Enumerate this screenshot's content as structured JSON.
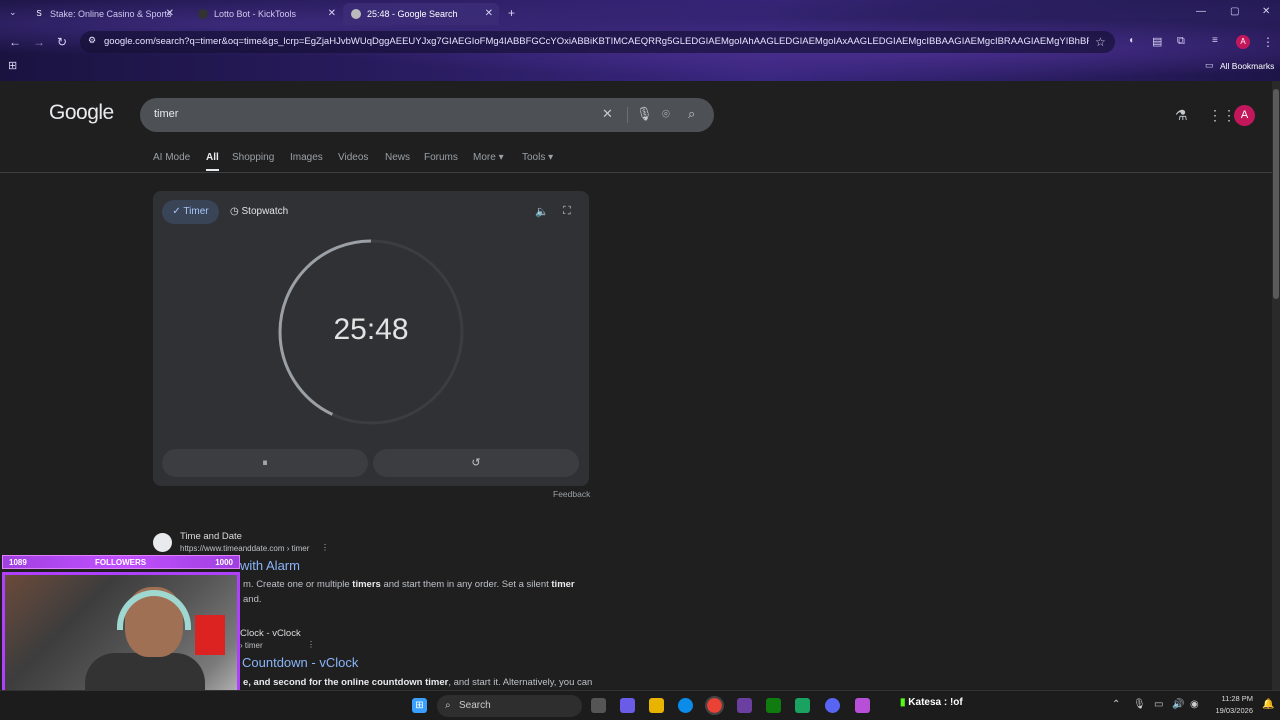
{
  "browser": {
    "tabs": [
      {
        "title": "Stake: Online Casino & Sports",
        "favicon": "S"
      },
      {
        "title": "Lotto Bot - KickTools",
        "favicon": ""
      },
      {
        "title": "25:48 - Google Search",
        "favicon": "G"
      }
    ],
    "new_tab": "+",
    "url": "google.com/search?q=timer&oq=time&gs_lcrp=EgZjaHJvbWUqDggAEEUYJxg7GIAEGIoFMg4IABBFGCcYOxiABBiKBTIMCAEQRRg5GLEDGIAEMgoIAhAAGLEDGIAEMgoIAxAAGLEDGIAEMgcIBBAAGIAEMgcIBRAAGIAEMgYIBhBFGD0yBggHEE...",
    "bookmarks_label": "All Bookmarks",
    "profile_initial": "A"
  },
  "google": {
    "logo": "Google",
    "query": "timer",
    "tabs": [
      "AI Mode",
      "All",
      "Shopping",
      "Images",
      "Videos",
      "News",
      "Forums",
      "More",
      "Tools"
    ],
    "avatar_initial": "A"
  },
  "timer_card": {
    "mode_timer": "Timer",
    "mode_stopwatch": "Stopwatch",
    "time": "25:48",
    "progress": 0.43,
    "feedback": "Feedback",
    "ring_color": "#9aa0a6"
  },
  "results": [
    {
      "site": "Time and Date",
      "url": "https://www.timeanddate.com › timer",
      "title": "with Alarm",
      "snippet_a": "m. Create one or multiple ",
      "snippet_b": "timers",
      "snippet_c": " and start them in any order. Set a silent ",
      "snippet_d": "timer",
      "snippet_line2": "and."
    },
    {
      "site": "Clock - vClock",
      "url": "› timer",
      "title": "Countdown - vClock",
      "snippet_a": "e, and second for the online countdown timer",
      "snippet_b": ", and start it. Alternatively, you can"
    }
  ],
  "overlay": {
    "left_count": "1089",
    "label": "FOLLOWERS",
    "right_count": "1000"
  },
  "taskbar": {
    "search_placeholder": "Search",
    "chat": "Katesa : !of",
    "time": "11:28 PM",
    "date": "19/03/2026"
  }
}
